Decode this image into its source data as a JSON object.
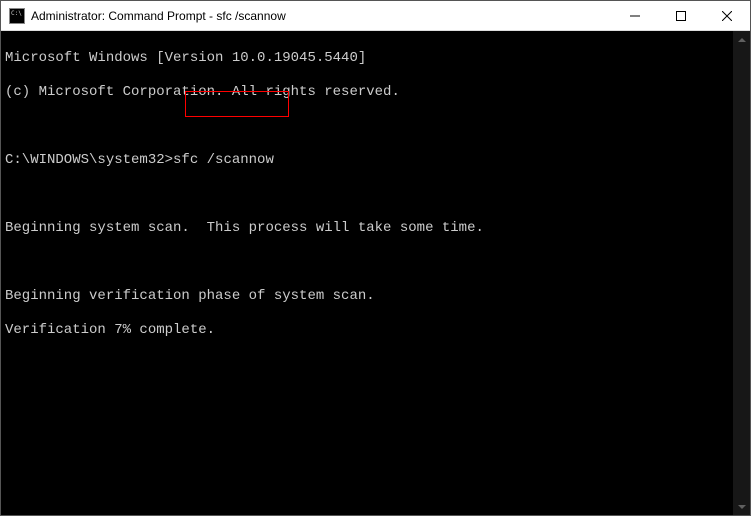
{
  "window": {
    "title": "Administrator: Command Prompt - sfc  /scannow"
  },
  "terminal": {
    "line1": "Microsoft Windows [Version 10.0.19045.5440]",
    "line2": "(c) Microsoft Corporation. All rights reserved.",
    "blank1": " ",
    "prompt": "C:\\WINDOWS\\system32>",
    "command": "sfc /scannow",
    "blank2": " ",
    "line4": "Beginning system scan.  This process will take some time.",
    "blank3": " ",
    "line5": "Beginning verification phase of system scan.",
    "line6": "Verification 7% complete."
  }
}
